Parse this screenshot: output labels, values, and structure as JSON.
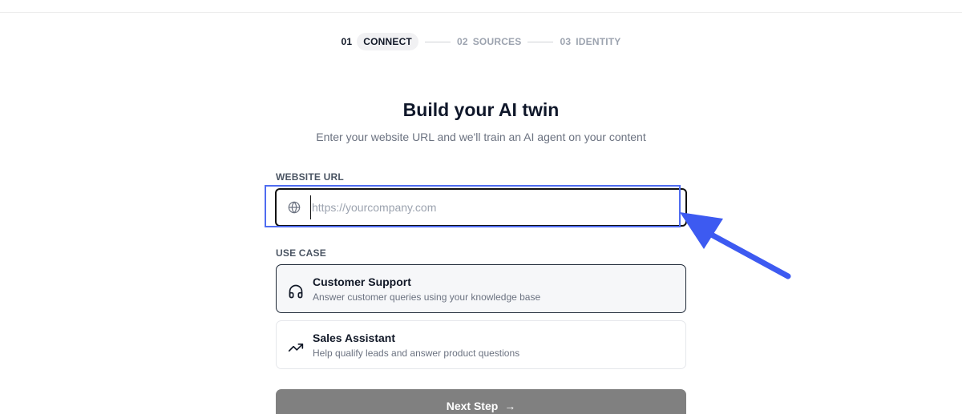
{
  "stepper": {
    "steps": [
      {
        "num": "01",
        "label": "CONNECT",
        "active": true
      },
      {
        "num": "02",
        "label": "SOURCES",
        "active": false
      },
      {
        "num": "03",
        "label": "IDENTITY",
        "active": false
      }
    ]
  },
  "header": {
    "title": "Build your AI twin",
    "subtitle": "Enter your website URL and we'll train an AI agent on your content"
  },
  "website": {
    "label": "WEBSITE URL",
    "placeholder": "https://yourcompany.com",
    "value": "",
    "icon": "globe-icon"
  },
  "use_case": {
    "label": "USE CASE",
    "options": [
      {
        "title": "Customer Support",
        "description": "Answer customer queries using your knowledge base",
        "icon": "headphones-icon",
        "selected": true
      },
      {
        "title": "Sales Assistant",
        "description": "Help qualify leads and answer product questions",
        "icon": "trending-up-icon",
        "selected": false
      }
    ]
  },
  "next_button": {
    "label": "Next Step",
    "arrow": "→"
  },
  "colors": {
    "highlight": "#4f6cf0",
    "annotation_arrow": "#3d5af1",
    "button_bg": "#808080"
  }
}
